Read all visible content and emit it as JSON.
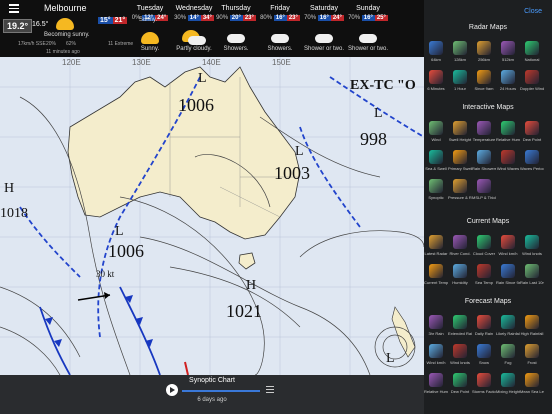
{
  "header": {
    "city": "Melbourne",
    "current_temp": "19.2°",
    "feels_like": "16.5°",
    "condition": "Becoming sunny.",
    "wind": "17km/h SSE",
    "rain_chance": "20%",
    "humidity": "62%",
    "updated": "11 minutes ago",
    "uv": "11 Extreme",
    "today": {
      "low": "15°",
      "high": "21°",
      "label": "Sunny."
    }
  },
  "forecast": [
    {
      "day": "Tuesday",
      "chance": "0%",
      "low": "12°",
      "high": "24°",
      "label": "Sunny.",
      "icon": "sun-icon"
    },
    {
      "day": "Wednesday",
      "chance": "30%",
      "low": "14°",
      "high": "34°",
      "label": "Partly cloudy.",
      "icon": "partly-cloudy-icon"
    },
    {
      "day": "Thursday",
      "chance": "90%",
      "low": "20°",
      "high": "23°",
      "label": "Showers.",
      "icon": "showers-icon"
    },
    {
      "day": "Friday",
      "chance": "80%",
      "low": "16°",
      "high": "23°",
      "label": "Showers.",
      "icon": "showers-icon"
    },
    {
      "day": "Saturday",
      "chance": "70%",
      "low": "16°",
      "high": "24°",
      "label": "Shower or two.",
      "icon": "showers-icon"
    },
    {
      "day": "Sunday",
      "chance": "70%",
      "low": "16°",
      "high": "25°",
      "label": "Shower or two.",
      "icon": "showers-icon"
    }
  ],
  "map": {
    "labels": {
      "lat": "120E",
      "lat2": "130E",
      "lat3": "140E",
      "lat4": "150E",
      "exto": "EX-TC \"O",
      "l1": "L",
      "p1006a": "1006",
      "l2": "L",
      "p998": "998",
      "l3": "L",
      "p1003": "1003",
      "h1": "H",
      "p1018": "1018",
      "l4": "L",
      "p1006b": "1006",
      "h2": "H",
      "p1021": "1021",
      "kt": "30 kt",
      "l5": "L"
    }
  },
  "bottom": {
    "title": "Synoptic Chart",
    "subtitle": "6 days ago"
  },
  "sidebar": {
    "close": "Close",
    "sections": [
      {
        "title": "Radar Maps",
        "items": [
          "64km",
          "128km",
          "256km",
          "512km",
          "National",
          "6 Minutes",
          "1 Hour",
          "Since 9am",
          "24 Hours",
          "Doppler Wind"
        ]
      },
      {
        "title": "Interactive Maps",
        "items": [
          "Wind",
          "Swell Height",
          "Temperature",
          "Relative Humidity",
          "Dew Point",
          "Sea & Swell",
          "Primary Swell",
          "Rain Showers",
          "Wind Waves",
          "Waves Period",
          "Synoptic",
          "Pressure & Rain",
          "MSLP & Thick."
        ]
      },
      {
        "title": "Current Maps",
        "items": [
          "Latest Radar",
          "River Cond.",
          "Cloud Cover",
          "Wind km/h",
          "Wind knots",
          "Current Temp.",
          "Humidity",
          "Sea Temp",
          "Rain Since 9am",
          "Rain Last 10m"
        ]
      },
      {
        "title": "Forecast Maps",
        "items": [
          "3hr Rain",
          "Extended Rainfall",
          "Daily Rain",
          "Likely Rainfall",
          "High Rainfall",
          "Wind km/h",
          "Wind knots",
          "Snow",
          "Fog",
          "Frost",
          "Relative Hum.",
          "Dew Point",
          "Storms Factor",
          "Mixing Height",
          "Mean Sea Level"
        ]
      }
    ]
  },
  "colors": {
    "accent": "#4a9cff",
    "isobar_blue": "#2244cc",
    "land": "#f4edcc",
    "sea": "#dfe7f2",
    "low_box": "#1a4fa8",
    "high_box": "#c0262a"
  }
}
